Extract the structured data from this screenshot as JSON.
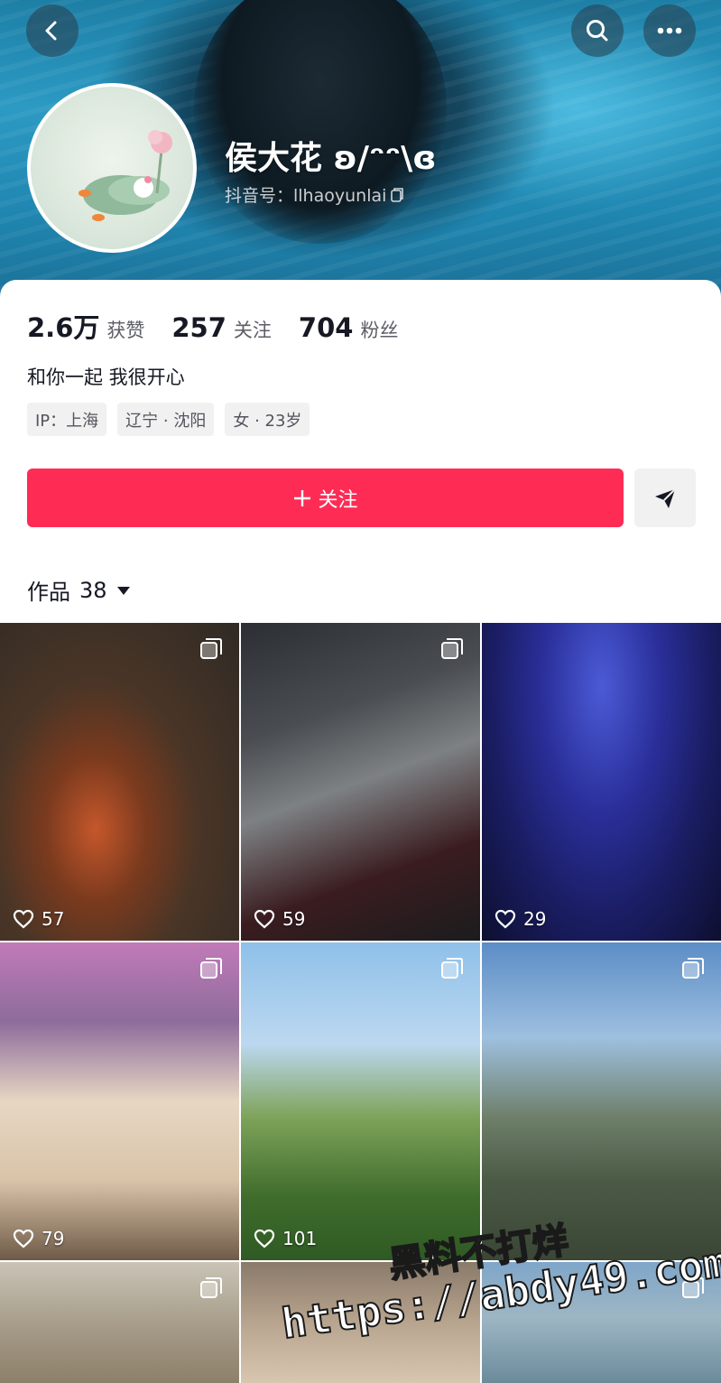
{
  "header": {
    "nickname": "侯大花 ʚ/ᵔᵔ\\ɞ",
    "douyin_id_label": "抖音号：llhaoyunlai",
    "icons": {
      "back": "back-arrow-icon",
      "search": "search-icon",
      "more": "more-dots-icon",
      "copy": "copy-icon"
    }
  },
  "stats": [
    {
      "num": "2.6万",
      "label": "获赞"
    },
    {
      "num": "257",
      "label": "关注"
    },
    {
      "num": "704",
      "label": "粉丝"
    }
  ],
  "bio": "和你一起 我很开心",
  "tags": [
    "IP：上海",
    "辽宁 · 沈阳",
    "女 · 23岁"
  ],
  "actions": {
    "follow_label": "关注",
    "follow_color": "#fe2c55",
    "share_icon": "send-icon"
  },
  "works": {
    "label": "作品",
    "count": "38",
    "items": [
      {
        "likes": "57"
      },
      {
        "likes": "59"
      },
      {
        "likes": "29"
      },
      {
        "likes": "79"
      },
      {
        "likes": "101"
      },
      {
        "likes": ""
      },
      {
        "likes": ""
      },
      {
        "likes": ""
      },
      {
        "likes": ""
      }
    ]
  },
  "watermark": {
    "line1": "黑料不打烊",
    "line2": "https://abdy49.com"
  }
}
